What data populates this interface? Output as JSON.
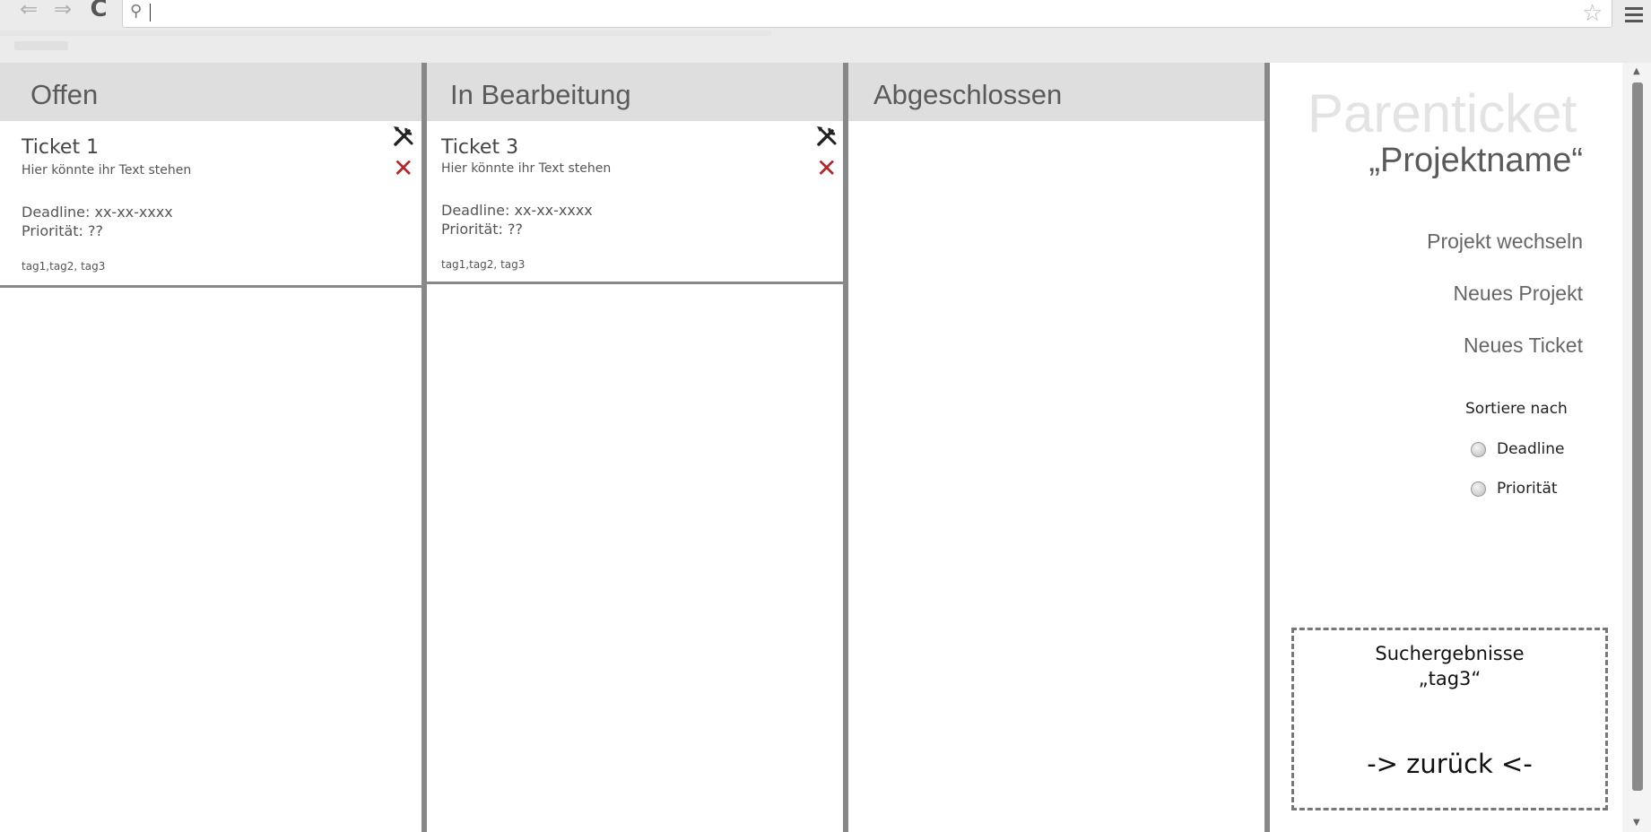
{
  "browser": {
    "back_icon": "back-arrow-icon",
    "forward_icon": "forward-arrow-icon",
    "reload_icon": "reload-icon",
    "search_icon": "magnifier-icon",
    "bookmark_icon": "star-icon",
    "menu_icon": "hamburger-menu-icon",
    "back_glyph": "⇐",
    "forward_glyph": "⇒",
    "reload_glyph": "C",
    "search_glyph": "⚲",
    "star_glyph": "☆",
    "omnibox_value": ""
  },
  "columns": [
    {
      "title": "Offen",
      "tickets": [
        {
          "name": "Ticket 1",
          "description": "Hier könnte ihr Text stehen",
          "deadline": "Deadline: xx-xx-xxxx",
          "priority": "Priorität: ??",
          "tags": "tag1,tag2, tag3"
        }
      ]
    },
    {
      "title": "In Bearbeitung",
      "tickets": [
        {
          "name": "Ticket 3",
          "description": "Hier könnte ihr Text stehen",
          "deadline": "Deadline: xx-xx-xxxx",
          "priority": "Priorität: ??",
          "tags": "tag1,tag2, tag3"
        }
      ]
    },
    {
      "title": "Abgeschlossen",
      "tickets": []
    }
  ],
  "ticket_actions": {
    "edit_icon": "tools-icon",
    "delete_icon": "close-icon",
    "delete_glyph": "✕",
    "delete_color": "#b3272a"
  },
  "sidebar": {
    "parent_title": "Parenticket",
    "project_name": "„Projektname“",
    "links": [
      "Projekt wechseln",
      "Neues Projekt",
      "Neues Ticket"
    ],
    "sort_label": "Sortiere nach",
    "sort_options": [
      "Deadline",
      "Priorität"
    ],
    "search_title": "Suchergebnisse",
    "search_term": "„tag3“",
    "back_label": "-> zurück <-"
  }
}
